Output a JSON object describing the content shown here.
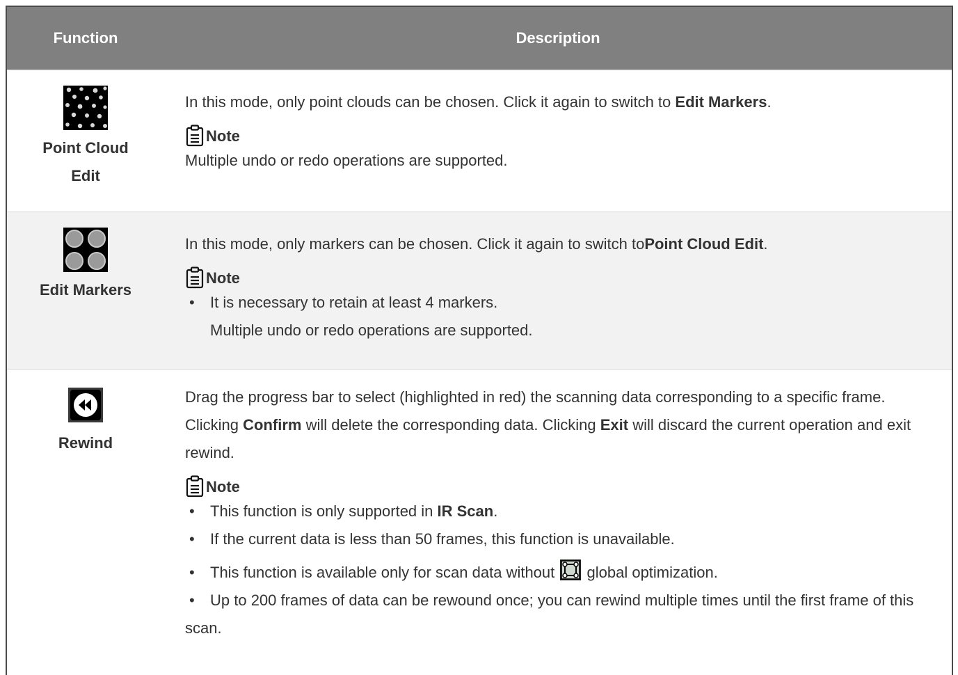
{
  "header": {
    "function": "Function",
    "description": "Description"
  },
  "rows": [
    {
      "function": "Point Cloud Edit",
      "icon": "point-cloud-icon",
      "desc_pre": "In this mode, only point clouds can be chosen. Click it again to switch to ",
      "desc_bold": "Edit Markers",
      "desc_post": ".",
      "note_label": "Note",
      "note_text": "Multiple undo or redo operations are supported."
    },
    {
      "function": "Edit Markers",
      "icon": "markers-icon",
      "desc_pre": "In this mode, only markers can be chosen. Click it again to switch to",
      "desc_bold": "Point Cloud Edit",
      "desc_post": ".",
      "note_label": "Note",
      "bullets": [
        "It is necessary to retain at least 4 markers.",
        "Multiple undo or redo operations are supported."
      ]
    },
    {
      "function": "Rewind",
      "icon": "rewind-icon",
      "desc_1": "Drag the progress bar to select (highlighted in red) the scanning data corresponding to a specific frame. Clicking ",
      "desc_bold_1": "Confirm",
      "desc_2": " will delete the corresponding data. Clicking ",
      "desc_bold_2": "Exit",
      "desc_3": " will discard the current operation and exit rewind.",
      "note_label": "Note",
      "b1_pre": "This function is only supported in ",
      "b1_bold": "IR Scan",
      "b1_post": ".",
      "b2": "If the current data is less than 50 frames, this function is unavailable.",
      "b3_pre": "This function is available only for scan data without ",
      "b3_icon": "global-optimization-icon",
      "b3_post": " global optimization.",
      "b4": "Up to 200 frames of data can be rewound once; you can rewind multiple times until the first frame of this scan."
    }
  ],
  "colors": {
    "header_bg": "#808080",
    "alt_row_bg": "#f2f2f2",
    "text": "#333333"
  }
}
